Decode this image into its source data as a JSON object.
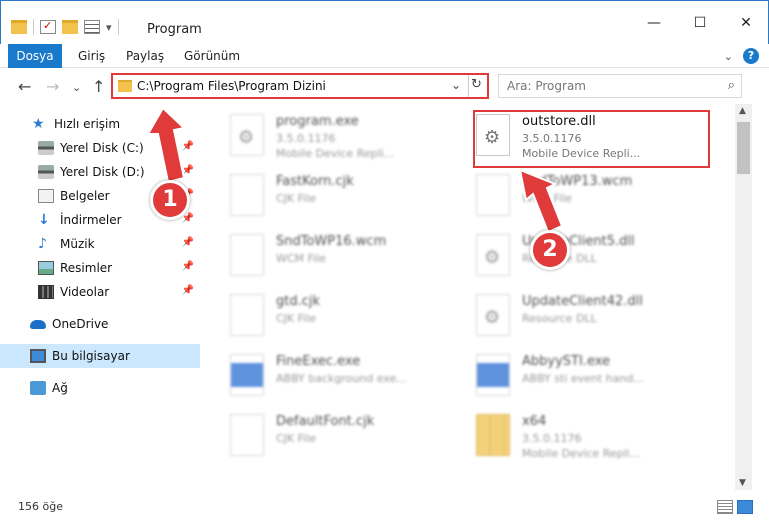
{
  "window": {
    "title": "Program",
    "controls": {
      "minimize": "—",
      "maximize": "☐",
      "close": "✕"
    }
  },
  "ribbon": {
    "file_tab": "Dosya",
    "tabs": [
      "Giriş",
      "Paylaş",
      "Görünüm"
    ]
  },
  "navigation": {
    "back": "←",
    "forward": "→",
    "recent": "⌄",
    "up": "↑",
    "address": "C:\\Program Files\\Program Dizini",
    "search_placeholder": "Ara: Program"
  },
  "sidebar": {
    "items": [
      {
        "label": "Hızlı erişim",
        "icon": "star-icon"
      },
      {
        "label": "Yerel Disk (C:)",
        "icon": "drive-icon",
        "pinned": true
      },
      {
        "label": "Yerel Disk (D:)",
        "icon": "drive-icon",
        "pinned": true
      },
      {
        "label": "Belgeler",
        "icon": "documents-icon",
        "pinned": true
      },
      {
        "label": "İndirmeler",
        "icon": "download-icon",
        "pinned": true
      },
      {
        "label": "Müzik",
        "icon": "music-icon",
        "pinned": true
      },
      {
        "label": "Resimler",
        "icon": "pictures-icon",
        "pinned": true
      },
      {
        "label": "Videolar",
        "icon": "videos-icon",
        "pinned": true
      },
      {
        "label": "OneDrive",
        "icon": "cloud-icon"
      },
      {
        "label": "Bu bilgisayar",
        "icon": "computer-icon",
        "selected": true
      },
      {
        "label": "Ağ",
        "icon": "network-icon"
      }
    ]
  },
  "files": [
    {
      "name": "program.exe",
      "meta1": "3.5.0.1176",
      "meta2": "Mobile Device Repli...",
      "icon": "gear-file-icon"
    },
    {
      "name": "outstore.dll",
      "meta1": "3.5.0.1176",
      "meta2": "Mobile Device Repli...",
      "icon": "gear-file-icon",
      "highlighted": true
    },
    {
      "name": "FastKorn.cjk",
      "meta1": "CJK File",
      "meta2": "",
      "icon": "blank-file-icon"
    },
    {
      "name": "SndToWP13.wcm",
      "meta1": "WCM File",
      "meta2": "",
      "icon": "blank-file-icon"
    },
    {
      "name": "SndToWP16.wcm",
      "meta1": "WCM File",
      "meta2": "",
      "icon": "blank-file-icon"
    },
    {
      "name": "UpdateClient5.dll",
      "meta1": "Resource DLL",
      "meta2": "",
      "icon": "gear-file-icon"
    },
    {
      "name": "gtd.cjk",
      "meta1": "CJK File",
      "meta2": "",
      "icon": "blank-file-icon"
    },
    {
      "name": "UpdateClient42.dll",
      "meta1": "Resource DLL",
      "meta2": "",
      "icon": "gear-file-icon"
    },
    {
      "name": "FineExec.exe",
      "meta1": "ABBY background exe...",
      "meta2": "",
      "icon": "exe-file-icon"
    },
    {
      "name": "AbbyySTI.exe",
      "meta1": "ABBY sti event hand...",
      "meta2": "",
      "icon": "exe-file-icon"
    },
    {
      "name": "DefaultFont.cjk",
      "meta1": "CJK File",
      "meta2": "",
      "icon": "blank-file-icon"
    },
    {
      "name": "x64",
      "meta1": "3.5.0.1176",
      "meta2": "Mobile Device Repli...",
      "icon": "zip-file-icon"
    }
  ],
  "annotations": {
    "step1": "1",
    "step2": "2"
  },
  "status": {
    "item_count": "156 öğe"
  },
  "colors": {
    "accent": "#1979ca",
    "highlight": "#e03a3a",
    "selection": "#cce8ff"
  }
}
